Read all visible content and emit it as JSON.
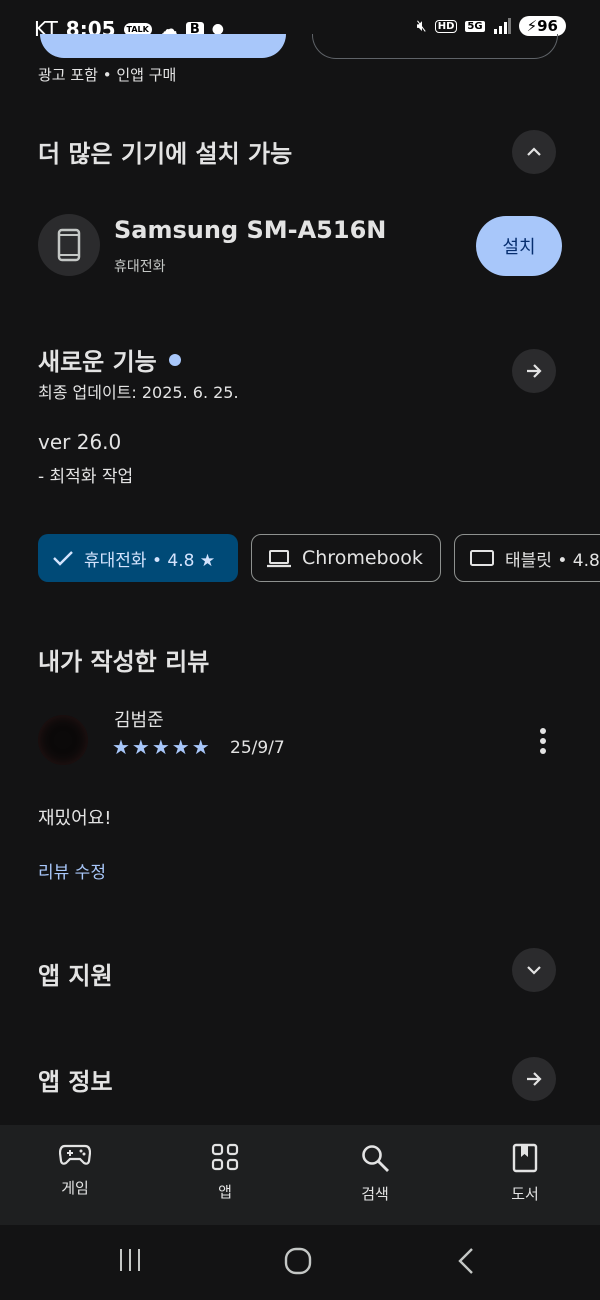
{
  "status_bar": {
    "carrier": "KT",
    "time": "8:05",
    "talk_badge": "TALK",
    "b_badge": "B",
    "hd": "HD",
    "network": "5G",
    "battery": "96"
  },
  "header_tags": "광고 포함 • 인앱 구매",
  "devices_section": {
    "title": "더 많은 기기에 설치 가능",
    "device_name": "Samsung SM-A516N",
    "device_type": "휴대전화",
    "install_label": "설치"
  },
  "whats_new": {
    "title": "새로운 기능",
    "updated": "최종 업데이트: 2025. 6. 25.",
    "version": "ver 26.0",
    "notes": "- 최적화 작업"
  },
  "chips": [
    {
      "label": "휴대전화 • 4.8 ★",
      "selected": true
    },
    {
      "label": "Chromebook",
      "selected": false
    },
    {
      "label": "태블릿 • 4.8",
      "selected": false
    }
  ],
  "my_review": {
    "title": "내가 작성한 리뷰",
    "author": "김범준",
    "stars": 5,
    "date": "25/9/7",
    "text": "재밌어요!",
    "edit_label": "리뷰 수정"
  },
  "app_support": {
    "title": "앱 지원"
  },
  "app_info": {
    "title": "앱 정보"
  },
  "bottom_nav": [
    {
      "label": "게임",
      "icon": "gamepad-icon"
    },
    {
      "label": "앱",
      "icon": "apps-grid-icon"
    },
    {
      "label": "검색",
      "icon": "search-icon"
    },
    {
      "label": "도서",
      "icon": "book-icon"
    }
  ],
  "colors": {
    "background": "#131314",
    "accent": "#a8c7fa",
    "chip_selected": "#004a77",
    "link": "#a8c7fa"
  }
}
